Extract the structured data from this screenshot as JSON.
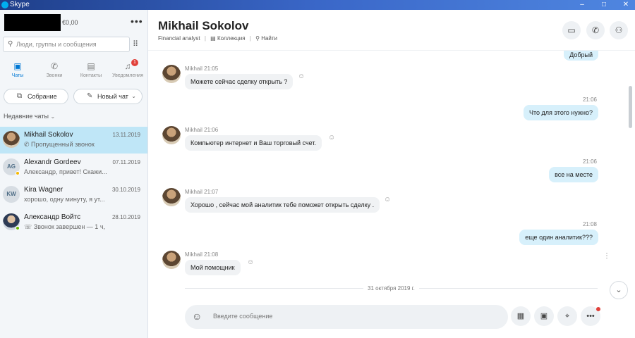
{
  "window": {
    "title": "Skype",
    "minimize": "–",
    "maximize": "□",
    "close": "✕"
  },
  "sidebar": {
    "credit": "€0,00",
    "more": "•••",
    "search_placeholder": "Люди, группы и сообщения",
    "tabs": [
      {
        "label": "Чаты",
        "icon": "chat-icon",
        "glyph": "▣",
        "active": true
      },
      {
        "label": "Звонки",
        "icon": "phone-icon",
        "glyph": "✆"
      },
      {
        "label": "Контакты",
        "icon": "contacts-icon",
        "glyph": "▤"
      },
      {
        "label": "Уведомления",
        "icon": "bell-icon",
        "glyph": "♫",
        "badge": "1"
      }
    ],
    "meeting_label": "Собрание",
    "new_chat_label": "Новый чат",
    "recent_label": "Недавние чаты",
    "chats": [
      {
        "name": "Mikhail Sokolov",
        "date": "13.11.2019",
        "preview": "✆ Пропущенный звонок",
        "selected": true
      },
      {
        "name": "Alexandr Gordeev",
        "initials": "AG",
        "date": "07.11.2019",
        "preview": "Александр, привет! Скажи..."
      },
      {
        "name": "Kira Wagner",
        "initials": "KW",
        "date": "30.10.2019",
        "preview": "хорошо, одну минуту, я ут..."
      },
      {
        "name": "Александр Войтс",
        "date": "28.10.2019",
        "preview": "☏ Звонок завершен — 1 ч,"
      }
    ]
  },
  "header": {
    "name": "Mikhail Sokolov",
    "role": "Financial analyst",
    "gallery": "Коллекция",
    "find": "Найти"
  },
  "messages": {
    "top_partial": "Добрый",
    "items": [
      {
        "meta": "Mikhail  21:05",
        "text": "Можете сейчас сделку открыть ?"
      },
      {
        "time": "21:06",
        "text": "Что для этого нужно?"
      },
      {
        "meta": "Mikhail  21:06",
        "text": "Компьютер интернет и Ваш торговый счет."
      },
      {
        "time": "21:06",
        "text": "все на месте"
      },
      {
        "meta": "Mikhail  21:07",
        "text": "Хорошо , сейчас мой аналитик тебе поможет открыть сделку ."
      },
      {
        "time": "21:08",
        "text": "еще один аналитик???"
      },
      {
        "meta": "Mikhail  21:08",
        "text": "Мой помощник"
      }
    ],
    "date_divider": "31 октября 2019 г."
  },
  "composer": {
    "placeholder": "Введите сообщение"
  },
  "colors": {
    "accent": "#0078d4",
    "selected": "#bfe6f7",
    "outgoing": "#d7f0fb",
    "incoming": "#f0f2f4",
    "badge": "#e1403a"
  }
}
